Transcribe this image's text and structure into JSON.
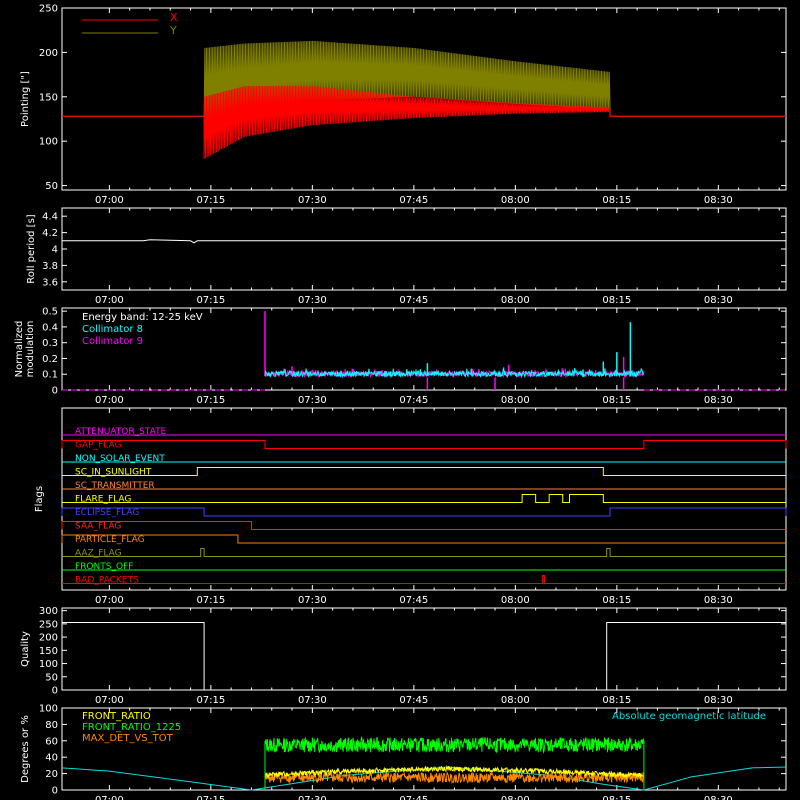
{
  "time_ticks": [
    "07:00",
    "07:15",
    "07:30",
    "07:45",
    "08:00",
    "08:15",
    "08:30"
  ],
  "colors": {
    "background": "#000000",
    "axes": "#ffffff",
    "x": "#ff0000",
    "y": "#808000",
    "collimator8": "#00ffff",
    "collimator9": "#ff00ff",
    "geomag": "#00dddd",
    "front_ratio": "#ffff00",
    "front_ratio_1225": "#00ff00",
    "max_det": "#ff8800"
  },
  "chart_data": [
    {
      "type": "line",
      "ylabel": "Pointing [\"]",
      "ylim": [
        45,
        250
      ],
      "yticks": [
        50,
        100,
        150,
        200,
        250
      ],
      "xlim_minutes": [
        -7,
        100
      ],
      "legend": [
        "X",
        "Y"
      ],
      "series": [
        {
          "name": "X",
          "baseline": 128,
          "active_start_min": 14,
          "active_end_min": 74,
          "envelope_low": [
            [
              14,
              80
            ],
            [
              20,
              105
            ],
            [
              30,
              118
            ],
            [
              45,
              126
            ],
            [
              60,
              131
            ],
            [
              74,
              133
            ]
          ],
          "envelope_high": [
            [
              14,
              150
            ],
            [
              20,
              162
            ],
            [
              30,
              162
            ],
            [
              45,
              150
            ],
            [
              60,
              143
            ],
            [
              74,
              138
            ]
          ]
        },
        {
          "name": "Y",
          "baseline": 128,
          "active_start_min": 14,
          "active_end_min": 74,
          "envelope_low": [
            [
              14,
              118
            ],
            [
              20,
              132
            ],
            [
              30,
              146
            ],
            [
              45,
              150
            ],
            [
              60,
              142
            ],
            [
              74,
              135
            ]
          ],
          "envelope_high": [
            [
              14,
              205
            ],
            [
              20,
              210
            ],
            [
              30,
              213
            ],
            [
              45,
              205
            ],
            [
              60,
              190
            ],
            [
              74,
              178
            ]
          ]
        }
      ]
    },
    {
      "type": "line",
      "ylabel": "Roll period [s]",
      "ylim": [
        3.5,
        4.5
      ],
      "yticks": [
        3.6,
        3.8,
        4.0,
        4.2,
        4.4
      ],
      "series": [
        {
          "name": "",
          "value": 4.1
        }
      ]
    },
    {
      "type": "bar",
      "ylabel": "Normalized modulation",
      "ylim": [
        0,
        0.52
      ],
      "yticks": [
        0.0,
        0.1,
        0.2,
        0.3,
        0.4,
        0.5
      ],
      "annotation": "Energy band: 12-25 keV",
      "active_start_min": 23,
      "active_end_min": 79,
      "legend": [
        "Collimator 8",
        "Collimator 9"
      ],
      "series": [
        {
          "name": "Collimator 8",
          "typical": 0.1,
          "peaks": [
            [
              47,
              0.17
            ],
            [
              70,
              0.13
            ],
            [
              73,
              0.18
            ],
            [
              75,
              0.24
            ],
            [
              77,
              0.43
            ]
          ]
        },
        {
          "name": "Collimator 9",
          "typical": 0.1,
          "peaks": [
            [
              23,
              0.5
            ],
            [
              27,
              0.15
            ],
            [
              59,
              0.16
            ],
            [
              76,
              0.21
            ]
          ]
        }
      ]
    },
    {
      "type": "line",
      "ylabel": "Flags",
      "flags": [
        {
          "name": "ATTENUATOR_STATE",
          "color": "#ff00ff",
          "on": []
        },
        {
          "name": "GAP_FLAG",
          "color": "#ff0000",
          "on": [
            [
              -7,
              23
            ],
            [
              79,
              100
            ]
          ]
        },
        {
          "name": "NON_SOLAR_EVENT",
          "color": "#00ffff",
          "on": []
        },
        {
          "name": "SC_IN_SUNLIGHT",
          "color": "#ffff00",
          "on": [
            [
              13,
              73
            ]
          ]
        },
        {
          "name": "SC_TRANSMITTER",
          "color": "#ff8040",
          "on": []
        },
        {
          "name": "FLARE_FLAG",
          "color": "#ffff00",
          "on": [
            [
              61,
              63
            ],
            [
              65,
              67
            ],
            [
              68,
              73
            ]
          ]
        },
        {
          "name": "ECLIPSE_FLAG",
          "color": "#4040ff",
          "on": [
            [
              -7,
              14
            ],
            [
              74,
              100
            ]
          ]
        },
        {
          "name": "SAA_FLAG",
          "color": "#ff2020",
          "on": [
            [
              -7,
              21
            ]
          ]
        },
        {
          "name": "PARTICLE_FLAG",
          "color": "#ff8000",
          "on": [
            [
              -7,
              19
            ]
          ]
        },
        {
          "name": "AAZ_FLAG",
          "color": "#909020",
          "on": [
            [
              13.5,
              14
            ],
            [
              73.5,
              74
            ]
          ]
        },
        {
          "name": "FRONTS_OFF",
          "color": "#00ff00",
          "on": []
        },
        {
          "name": "BAD_PACKETS",
          "color": "#ff0000",
          "on": [
            [
              64,
              64.3
            ]
          ]
        }
      ]
    },
    {
      "type": "line",
      "ylabel": "Quality",
      "ylim": [
        0,
        310
      ],
      "yticks": [
        0,
        50,
        100,
        150,
        200,
        250,
        300
      ],
      "series": [
        {
          "name": "",
          "points": [
            [
              -7,
              255
            ],
            [
              14,
              255
            ],
            [
              14,
              0
            ],
            [
              73.5,
              0
            ],
            [
              73.5,
              255
            ],
            [
              100,
              255
            ]
          ]
        }
      ]
    },
    {
      "type": "line",
      "ylabel": "Degrees or %",
      "ylim": [
        0,
        100
      ],
      "yticks": [
        0,
        20,
        40,
        60,
        80,
        100
      ],
      "legend": [
        "FRONT_RATIO",
        "FRONT_RATIO_1225",
        "MAX_DET_VS_TOT"
      ],
      "right_label": "Absolute geomagnetic latitude",
      "series": [
        {
          "name": "Absolute geomagnetic latitude",
          "points": [
            [
              -7,
              27
            ],
            [
              0,
              23
            ],
            [
              12,
              10
            ],
            [
              21,
              0
            ],
            [
              35,
              18
            ],
            [
              50,
              28
            ],
            [
              65,
              18
            ],
            [
              73,
              7
            ],
            [
              79,
              0
            ],
            [
              86,
              16
            ],
            [
              95,
              27
            ],
            [
              100,
              28
            ]
          ]
        },
        {
          "name": "FRONT_RATIO",
          "typical": 22,
          "range": [
            23,
            79
          ]
        },
        {
          "name": "FRONT_RATIO_1225",
          "typical": 55,
          "range": [
            23,
            79
          ]
        },
        {
          "name": "MAX_DET_VS_TOT",
          "typical": 15,
          "range": [
            23,
            79
          ]
        }
      ]
    }
  ]
}
